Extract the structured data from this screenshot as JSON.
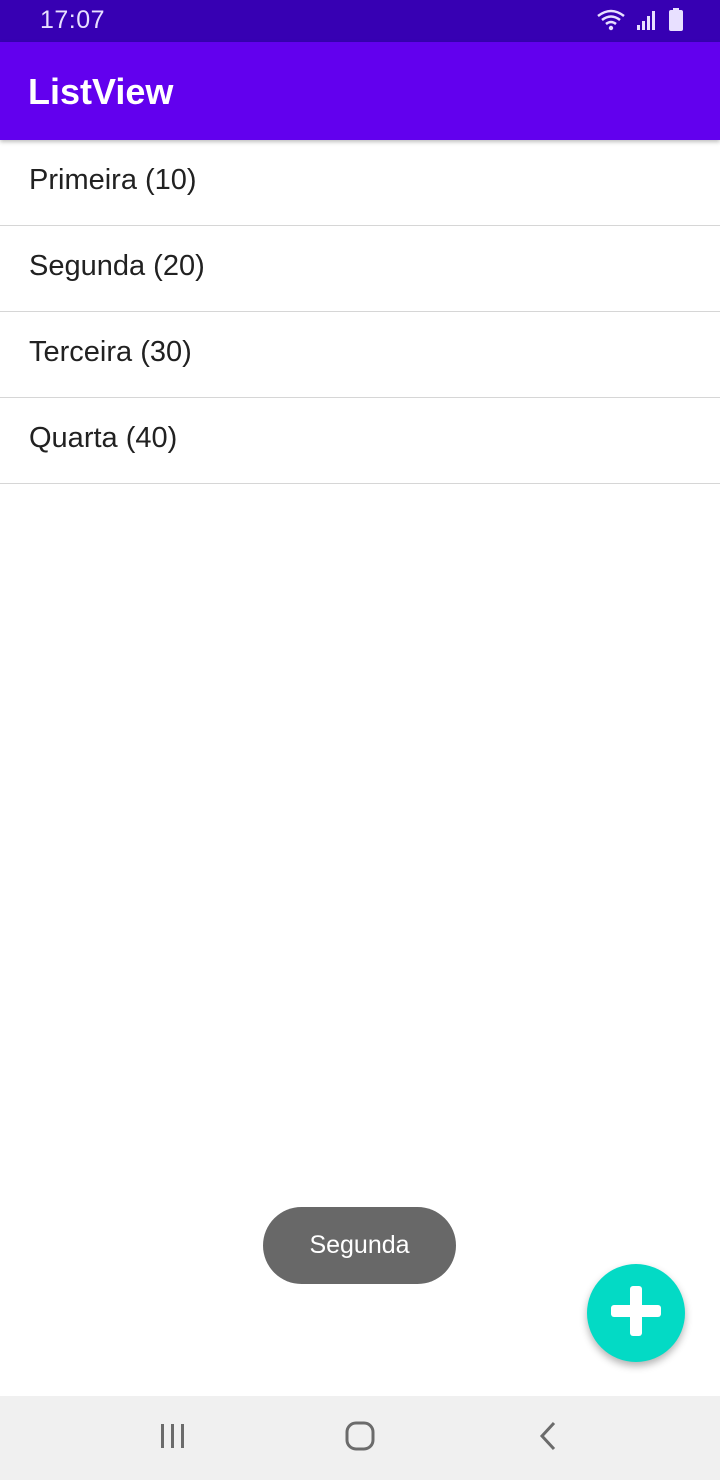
{
  "status_bar": {
    "time": "17:07",
    "icons": [
      "wifi-icon",
      "signal-icon",
      "battery-icon"
    ]
  },
  "app_bar": {
    "title": "ListView",
    "color": "#6200ee"
  },
  "list": {
    "items": [
      {
        "label": "Primeira (10)"
      },
      {
        "label": "Segunda (20)"
      },
      {
        "label": "Terceira (30)"
      },
      {
        "label": "Quarta (40)"
      }
    ]
  },
  "toast": {
    "text": "Segunda"
  },
  "fab": {
    "icon": "plus-icon",
    "color": "#03dac5"
  },
  "nav_bar": {
    "buttons": [
      "recent-apps-icon",
      "home-icon",
      "back-icon"
    ]
  }
}
